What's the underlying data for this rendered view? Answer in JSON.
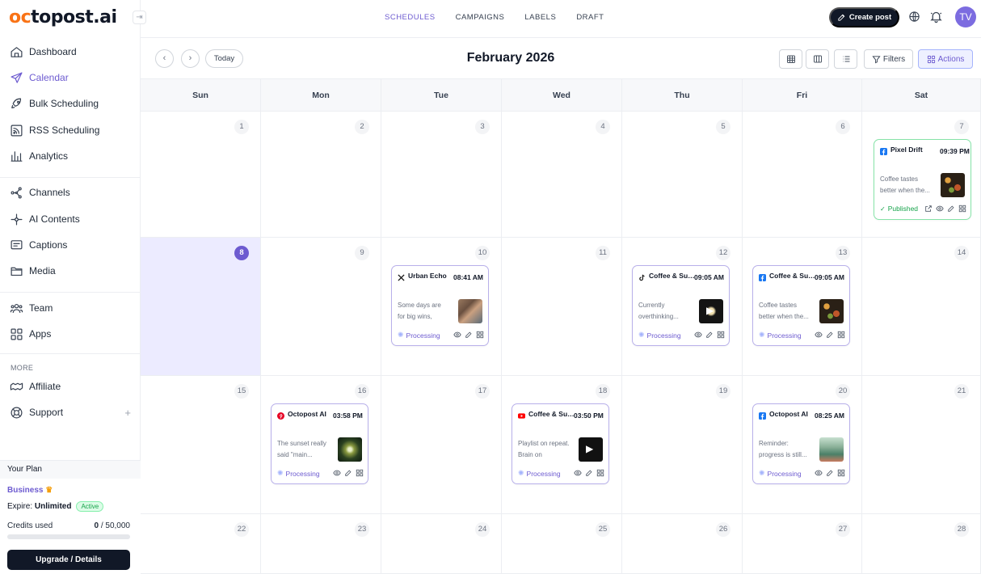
{
  "brand": {
    "logo_prefix": "oc",
    "logo_rest": "topost.ai",
    "accent": "#6d5bd0",
    "logo_color": "#f97316"
  },
  "sidebar": {
    "items": [
      {
        "label": "Dashboard",
        "icon": "home-icon",
        "active": false
      },
      {
        "label": "Calendar",
        "icon": "send-icon",
        "active": true
      },
      {
        "label": "Bulk Scheduling",
        "icon": "rocket-icon",
        "active": false
      },
      {
        "label": "RSS Scheduling",
        "icon": "rss-icon",
        "active": false
      },
      {
        "label": "Analytics",
        "icon": "bar-chart-icon",
        "active": false
      },
      {
        "label": "Channels",
        "icon": "network-icon",
        "active": false
      },
      {
        "label": "AI Contents",
        "icon": "sparkles-icon",
        "active": false
      },
      {
        "label": "Captions",
        "icon": "caption-icon",
        "active": false
      },
      {
        "label": "Media",
        "icon": "folder-icon",
        "active": false
      },
      {
        "label": "Team",
        "icon": "team-icon",
        "active": false
      },
      {
        "label": "Apps",
        "icon": "apps-icon",
        "active": false
      }
    ],
    "more_label": "MORE",
    "more_items": [
      {
        "label": "Affiliate",
        "icon": "affiliate-icon"
      },
      {
        "label": "Support",
        "icon": "lifebuoy-icon"
      }
    ],
    "plan": {
      "header": "Your Plan",
      "name": "Business",
      "expire_label": "Expire:",
      "expire_value": "Unlimited",
      "status": "Active",
      "credits_label": "Credits used",
      "credits_used": "0",
      "credits_total": "/ 50,000",
      "upgrade_label": "Upgrade / Details"
    }
  },
  "topbar": {
    "tabs": [
      {
        "label": "SCHEDULES",
        "active": true
      },
      {
        "label": "CAMPAIGNS",
        "active": false
      },
      {
        "label": "LABELS",
        "active": false
      },
      {
        "label": "DRAFT",
        "active": false
      }
    ],
    "create_label": "Create post",
    "avatar_initials": "TV"
  },
  "toolbar": {
    "today_label": "Today",
    "month": "February 2026",
    "filters_label": "Filters",
    "actions_label": "Actions"
  },
  "calendar": {
    "weekdays": [
      "Sun",
      "Mon",
      "Tue",
      "Wed",
      "Thu",
      "Fri",
      "Sat"
    ],
    "weeks": [
      [
        1,
        2,
        3,
        4,
        5,
        6,
        7
      ],
      [
        8,
        9,
        10,
        11,
        12,
        13,
        14
      ],
      [
        15,
        16,
        17,
        18,
        19,
        20,
        21
      ],
      [
        22,
        23,
        24,
        25,
        26,
        27,
        28
      ]
    ],
    "today": 8,
    "posts": [
      {
        "day": 7,
        "network": "facebook",
        "name": "Pixel Drift",
        "time": "09:39 PM",
        "text": "Coffee tastes better when the...",
        "status": "Published",
        "thumb": "food"
      },
      {
        "day": 10,
        "network": "x",
        "name": "Urban Echo",
        "time": "08:41 AM",
        "text": "Some days are for big wins, some...",
        "status": "Processing",
        "thumb": "rocks"
      },
      {
        "day": 12,
        "network": "tiktok",
        "name": "Coffee & Sunsets",
        "time": "09:05 AM",
        "text": "Currently overthinking...",
        "status": "Processing",
        "thumb": "dark-video"
      },
      {
        "day": 13,
        "network": "facebook",
        "name": "Coffee & Sunsets",
        "time": "09:05 AM",
        "text": "Coffee tastes better when the...",
        "status": "Processing",
        "thumb": "food"
      },
      {
        "day": 16,
        "network": "pinterest",
        "name": "Octopost AI",
        "time": "03:58 PM",
        "text": "The sunset really said \"main...",
        "status": "Processing",
        "thumb": "burst"
      },
      {
        "day": 18,
        "network": "youtube",
        "name": "Coffee & Sunsets",
        "time": "03:50 PM",
        "text": "Playlist on repeat. Brain on airplane...",
        "status": "Processing",
        "thumb": "video"
      },
      {
        "day": 20,
        "network": "facebook",
        "name": "Octopost AI",
        "time": "08:25 AM",
        "text": "Reminder: progress is still...",
        "status": "Processing",
        "thumb": "landscape"
      }
    ]
  }
}
